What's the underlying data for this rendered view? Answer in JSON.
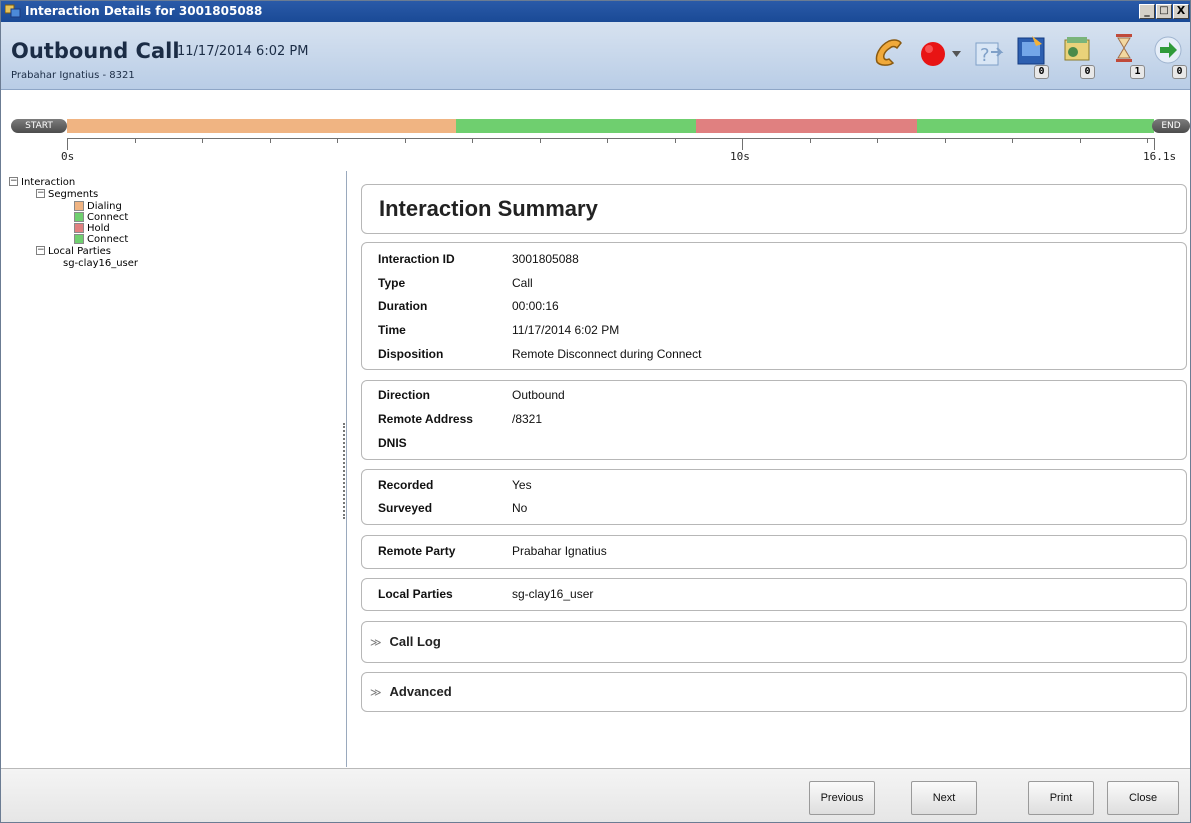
{
  "window": {
    "title": "Interaction Details for 3001805088",
    "buttons": {
      "minimize": "_",
      "maximize": "□",
      "close": "X"
    }
  },
  "header": {
    "call_title": "Outbound Call",
    "call_time": "11/17/2014 6:02 PM",
    "call_party": "Prabahar Ignatius - 8321",
    "toolbar": [
      {
        "icon": "phone-handset-icon"
      },
      {
        "icon": "record-icon",
        "color": "#e81414"
      },
      {
        "icon": "dropdown-arrow-icon"
      },
      {
        "icon": "help-transfer-icon"
      },
      {
        "icon": "screen-recording-icon",
        "badge": "0"
      },
      {
        "icon": "attachment-icon",
        "badge": "0"
      },
      {
        "icon": "hourglass-icon",
        "badge": "1"
      },
      {
        "icon": "forward-arrow-icon",
        "badge": "0"
      }
    ]
  },
  "timeline": {
    "start_label": "START",
    "end_label": "END",
    "total_seconds": 16.1,
    "tick_labels": {
      "start": "0s",
      "mid": "10s",
      "end": "16.1s"
    },
    "segments": [
      {
        "name": "Dialing",
        "color": "#f0b482"
      },
      {
        "name": "Connect",
        "color": "#6fcf6f"
      },
      {
        "name": "Hold",
        "color": "#e08080"
      },
      {
        "name": "Connect",
        "color": "#6fcf6f"
      }
    ]
  },
  "tree": {
    "root": "Interaction",
    "segments_label": "Segments",
    "local_parties_label": "Local Parties",
    "local_party": "sg-clay16_user",
    "collapse_glyph": "−"
  },
  "summary": {
    "title": "Interaction Summary",
    "groups": [
      [
        {
          "label": "Interaction ID",
          "value": "3001805088"
        },
        {
          "label": "Type",
          "value": "Call"
        },
        {
          "label": "Duration",
          "value": "00:00:16"
        },
        {
          "label": "Time",
          "value": "11/17/2014 6:02 PM"
        },
        {
          "label": "Disposition",
          "value": "Remote Disconnect during Connect"
        }
      ],
      [
        {
          "label": "Direction",
          "value": "Outbound"
        },
        {
          "label": "Remote Address",
          "value": "/8321"
        },
        {
          "label": "DNIS",
          "value": ""
        }
      ],
      [
        {
          "label": "Recorded",
          "value": "Yes"
        },
        {
          "label": "Surveyed",
          "value": "No"
        }
      ],
      [
        {
          "label": "Remote Party",
          "value": "Prabahar Ignatius"
        }
      ],
      [
        {
          "label": "Local Parties",
          "value": "sg-clay16_user"
        }
      ]
    ],
    "expanders": [
      {
        "label": "Call Log",
        "glyph": "≫"
      },
      {
        "label": "Advanced",
        "glyph": "≫"
      }
    ]
  },
  "footer": {
    "previous": "Previous",
    "next": "Next",
    "print": "Print",
    "close": "Close"
  }
}
